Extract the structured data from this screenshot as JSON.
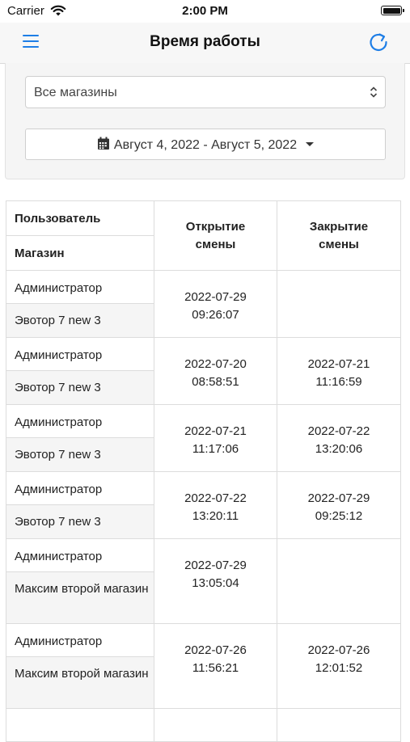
{
  "status_bar": {
    "carrier": "Carrier",
    "time": "2:00 PM"
  },
  "nav": {
    "title": "Время работы",
    "menu_icon": "hamburger-menu-icon",
    "refresh_icon": "refresh-icon"
  },
  "filters": {
    "store_select": {
      "value": "Все магазины"
    },
    "date_range": {
      "label": "Август 4, 2022 - Август 5, 2022"
    }
  },
  "table": {
    "headers": {
      "user": "Пользователь",
      "store": "Магазин",
      "open": "Открытие смены",
      "close": "Закрытие смены"
    },
    "rows": [
      {
        "user": "Администратор",
        "store": "Эвотор 7 new 3",
        "open_date": "2022-07-29",
        "open_time": "09:26:07",
        "close_date": "",
        "close_time": ""
      },
      {
        "user": "Администратор",
        "store": "Эвотор 7 new 3",
        "open_date": "2022-07-20",
        "open_time": "08:58:51",
        "close_date": "2022-07-21",
        "close_time": "11:16:59"
      },
      {
        "user": "Администратор",
        "store": "Эвотор 7 new 3",
        "open_date": "2022-07-21",
        "open_time": "11:17:06",
        "close_date": "2022-07-22",
        "close_time": "13:20:06"
      },
      {
        "user": "Администратор",
        "store": "Эвотор 7 new 3",
        "open_date": "2022-07-22",
        "open_time": "13:20:11",
        "close_date": "2022-07-29",
        "close_time": "09:25:12"
      },
      {
        "user": "Администратор",
        "store": "Максим второй магазин",
        "open_date": "2022-07-29",
        "open_time": "13:05:04",
        "close_date": "",
        "close_time": ""
      },
      {
        "user": "Администратор",
        "store": "Максим второй магазин",
        "open_date": "2022-07-26",
        "open_time": "11:56:21",
        "close_date": "2022-07-26",
        "close_time": "12:01:52"
      }
    ]
  }
}
